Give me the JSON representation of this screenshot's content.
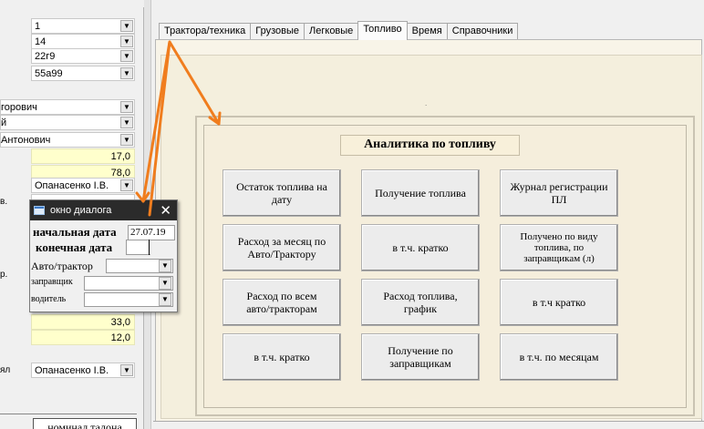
{
  "left_form": {
    "rows": [
      {
        "value": "1",
        "kind": "combo"
      },
      {
        "value": "14",
        "kind": "combo"
      },
      {
        "value": "22г9",
        "kind": "combo"
      },
      {
        "value": "55а99",
        "kind": "combo"
      },
      {
        "value": "горович",
        "kind": "combo"
      },
      {
        "value": "й",
        "kind": "combo"
      },
      {
        "value": "Антонович",
        "kind": "combo"
      },
      {
        "value": "17,0",
        "kind": "num"
      },
      {
        "value": "78,0",
        "kind": "num"
      },
      {
        "label": "",
        "value": "Опанасенко І.В.",
        "kind": "combo"
      },
      {
        "label": "в.",
        "value": "",
        "kind": "plain"
      },
      {
        "label": "р.",
        "value": "",
        "kind": "plain"
      },
      {
        "value": "33,0",
        "kind": "num"
      },
      {
        "value": "12,0",
        "kind": "num"
      },
      {
        "label": "ял",
        "value": "Опанасенко І.В.",
        "kind": "combo"
      }
    ],
    "grid_header": "номинал талона"
  },
  "tabs": [
    {
      "label": "Трактора/техника",
      "active": false
    },
    {
      "label": "Грузовые",
      "active": false
    },
    {
      "label": "Легковые",
      "active": false
    },
    {
      "label": "Топливо",
      "active": true
    },
    {
      "label": "Время",
      "active": false
    },
    {
      "label": "Справочники",
      "active": false
    }
  ],
  "fuel_panel": {
    "title": "Аналитика по топливу",
    "buttons": [
      "Остаток топлива на\nдату",
      "Получение топлива",
      "Журнал регистрации\nПЛ",
      "Расход за месяц по\nАвто/Трактору",
      "в т.ч. кратко",
      "Получено по виду\nтоплива,  по\nзаправщикам (л)",
      "Расход по всем\nавто/тракторам",
      "Расход топлива,\nграфик",
      "в т.ч  кратко",
      "в т.ч. кратко",
      "Получение по\nзаправщикам",
      "в т.ч. по месяцам"
    ]
  },
  "dialog": {
    "title": "окно диалога",
    "start_date_label": "начальная дата",
    "start_date_value": "27.07.19",
    "end_date_label": "конечная дата",
    "end_date_value": "",
    "vehicle_label": "Авто/трактор",
    "refueler_label": "заправщик",
    "driver_label": "водитель"
  },
  "colors": {
    "annotation_arrow": "#f07d1e",
    "panel_bg": "#f4efdd",
    "dialog_titlebar": "#2b2b2b",
    "highlight_field": "#ffffcc"
  }
}
